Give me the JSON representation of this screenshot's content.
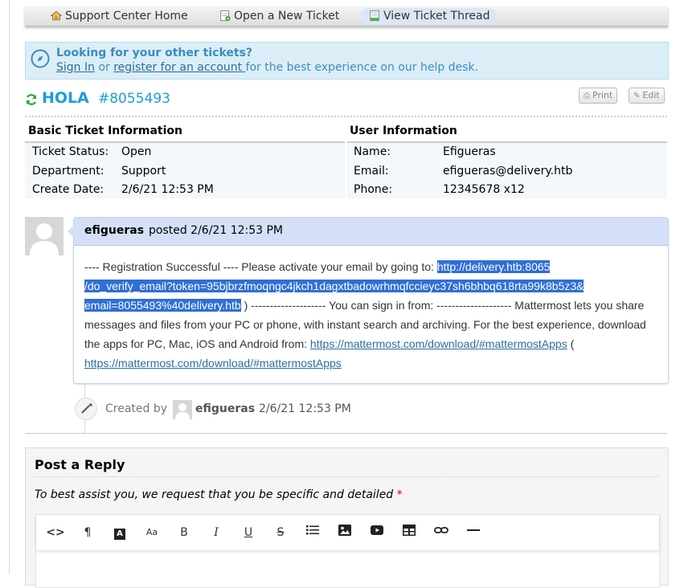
{
  "nav": {
    "home": "Support Center Home",
    "new_ticket": "Open a New Ticket",
    "view_thread": "View Ticket Thread"
  },
  "notice": {
    "title": "Looking for your other tickets?",
    "sign_in": "Sign In",
    "or": " or ",
    "register": "register for an account ",
    "rest": "for the best experience on our help desk."
  },
  "ticket": {
    "subject": "HOLA",
    "number": "#8055493",
    "print_label": "Print",
    "edit_label": "Edit"
  },
  "basic_info": {
    "heading": "Basic Ticket Information",
    "status_label": "Ticket Status:",
    "status": "Open",
    "department_label": "Department:",
    "department": "Support",
    "created_label": "Create Date:",
    "created": "2/6/21 12:53 PM"
  },
  "user_info": {
    "heading": "User Information",
    "name_label": "Name:",
    "name": "Efigueras",
    "email_label": "Email:",
    "email": "efigueras@delivery.htb",
    "phone_label": "Phone:",
    "phone": "12345678 x12"
  },
  "thread": {
    "author": "efigueras",
    "posted": "posted 2/6/21 12:53 PM",
    "body_start": "---- Registration Successful ---- Please activate your email by going to: ",
    "verify_link_1": "http://delivery.htb:8065",
    "verify_link_2": "/do_verify_email?token=95bjbrzfmoqngc4jkch1dagxtbadowrhmqfccieyc37sh6bhbq618rta99k8b5z3&",
    "verify_link_3": "email=8055493%40delivery.htb",
    "body_middle": " ) -------------------- You can sign in from: -------------------- Mattermost lets you share messages and files from your PC or phone, with instant search and archiving. For the best experience, download the apps for PC, Mac, iOS and Android from: ",
    "app_link_1": "https://mattermost.com/download/#mattermostApps",
    "body_paren": " (",
    "app_link_2": "https://mattermost.com/download/#mattermostApps"
  },
  "event": {
    "label": "Created by",
    "user": "efigueras",
    "date": "2/6/21 12:53 PM"
  },
  "reply": {
    "title": "Post a Reply",
    "hint": "To best assist you, we request that you be specific and detailed",
    "required_mark": "*"
  },
  "toolbar_icons": [
    "code-view",
    "paragraph",
    "text-color",
    "font-size",
    "bold",
    "italic",
    "underline",
    "strikethrough",
    "list",
    "image",
    "video",
    "table",
    "link",
    "horizontal-rule"
  ],
  "colors": {
    "accent": "#199fd8",
    "notice_bg": "#dbeef7",
    "thread_header": "#d4e0f7",
    "selection": "#2f6fd6"
  }
}
